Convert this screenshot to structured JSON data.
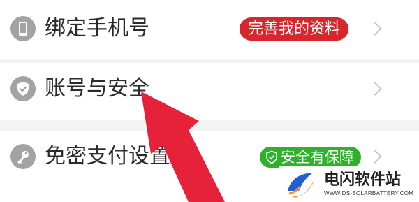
{
  "settings": {
    "rows": [
      {
        "icon": "phone-icon",
        "label": "绑定手机号",
        "badge": "完善我的资料",
        "badge_color": "#d8262f"
      },
      {
        "icon": "shield-check-icon",
        "label": "账号与安全"
      },
      {
        "icon": "key-icon",
        "label": "免密支付设置",
        "badge": "安全有保障",
        "badge_color": "#31b02c"
      }
    ]
  },
  "annotation": {
    "arrow_color": "#e6223a",
    "arrow_icon": "pointer-arrow-icon"
  },
  "watermark": {
    "name": "电闪软件站",
    "url": "WWW.DS-SOLARBATTERY.COM"
  }
}
